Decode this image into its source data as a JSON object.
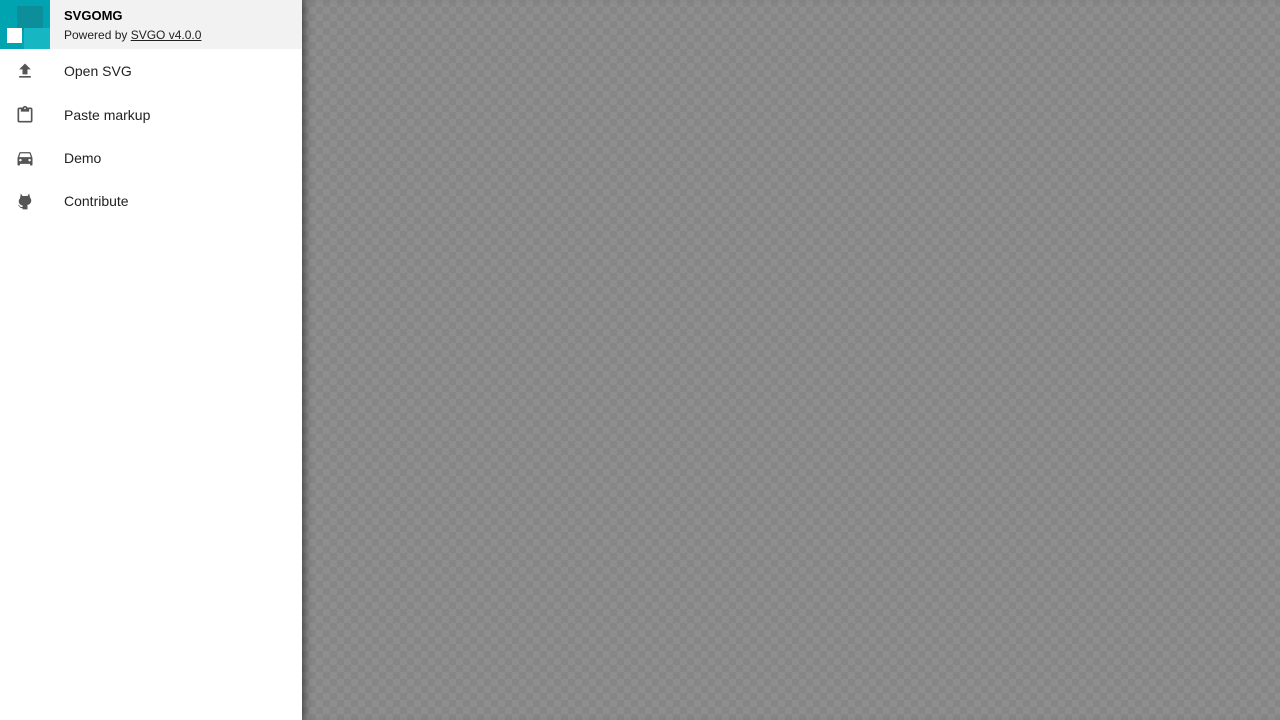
{
  "header": {
    "title": "SVGOMG",
    "powered_prefix": "Powered by",
    "powered_link": "SVGO v4.0.0",
    "logo_colors": {
      "base": "#00a3b0",
      "dark": "#0d8f9b",
      "light": "#16b6c2",
      "white": "#ffffff"
    }
  },
  "menu": {
    "items": [
      {
        "label": "Open SVG",
        "icon": "upload-icon"
      },
      {
        "label": "Paste markup",
        "icon": "clipboard-icon"
      },
      {
        "label": "Demo",
        "icon": "car-icon"
      },
      {
        "label": "Contribute",
        "icon": "github-icon"
      }
    ]
  },
  "colors": {
    "drawer_bg": "#ffffff",
    "header_bg": "#f2f2f2",
    "canvas_bg": "#8e8e8e",
    "icon": "#555555"
  }
}
